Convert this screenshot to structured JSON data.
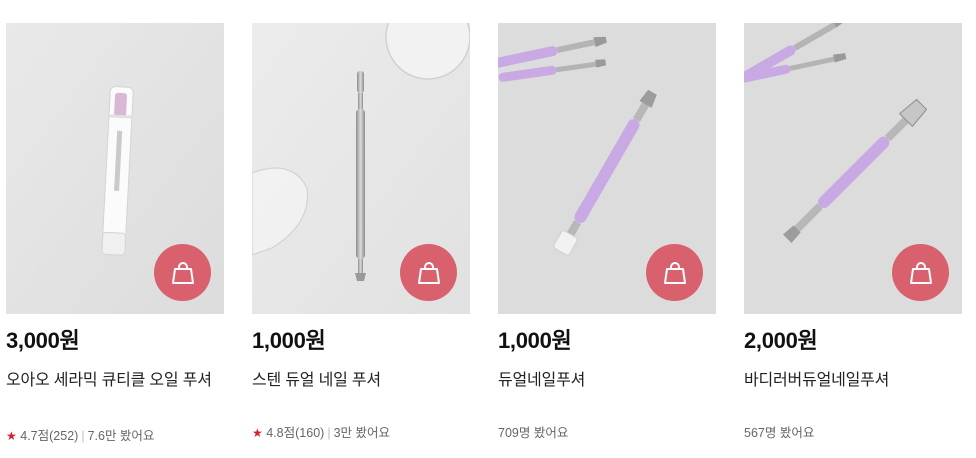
{
  "products": [
    {
      "price": "3,000원",
      "name": "오아오 세라믹 큐티클 오일 푸셔",
      "rating": "4.7점(252)",
      "views": "7.6만 봤어요",
      "cart_icon": "shopping-bag-icon"
    },
    {
      "price": "1,000원",
      "name": "스텐 듀얼 네일 푸셔",
      "rating": "4.8점(160)",
      "views": "3만 봤어요",
      "cart_icon": "shopping-bag-icon"
    },
    {
      "price": "1,000원",
      "name": "듀얼네일푸셔",
      "views": "709명 봤어요",
      "cart_icon": "shopping-bag-icon"
    },
    {
      "price": "2,000원",
      "name": "바디러버듀얼네일푸셔",
      "views": "567명 봤어요",
      "cart_icon": "shopping-bag-icon"
    }
  ],
  "colors": {
    "cart_button": "#d9616e",
    "star": "#d81f2b",
    "pusher_purple": "#c8a9e3"
  }
}
